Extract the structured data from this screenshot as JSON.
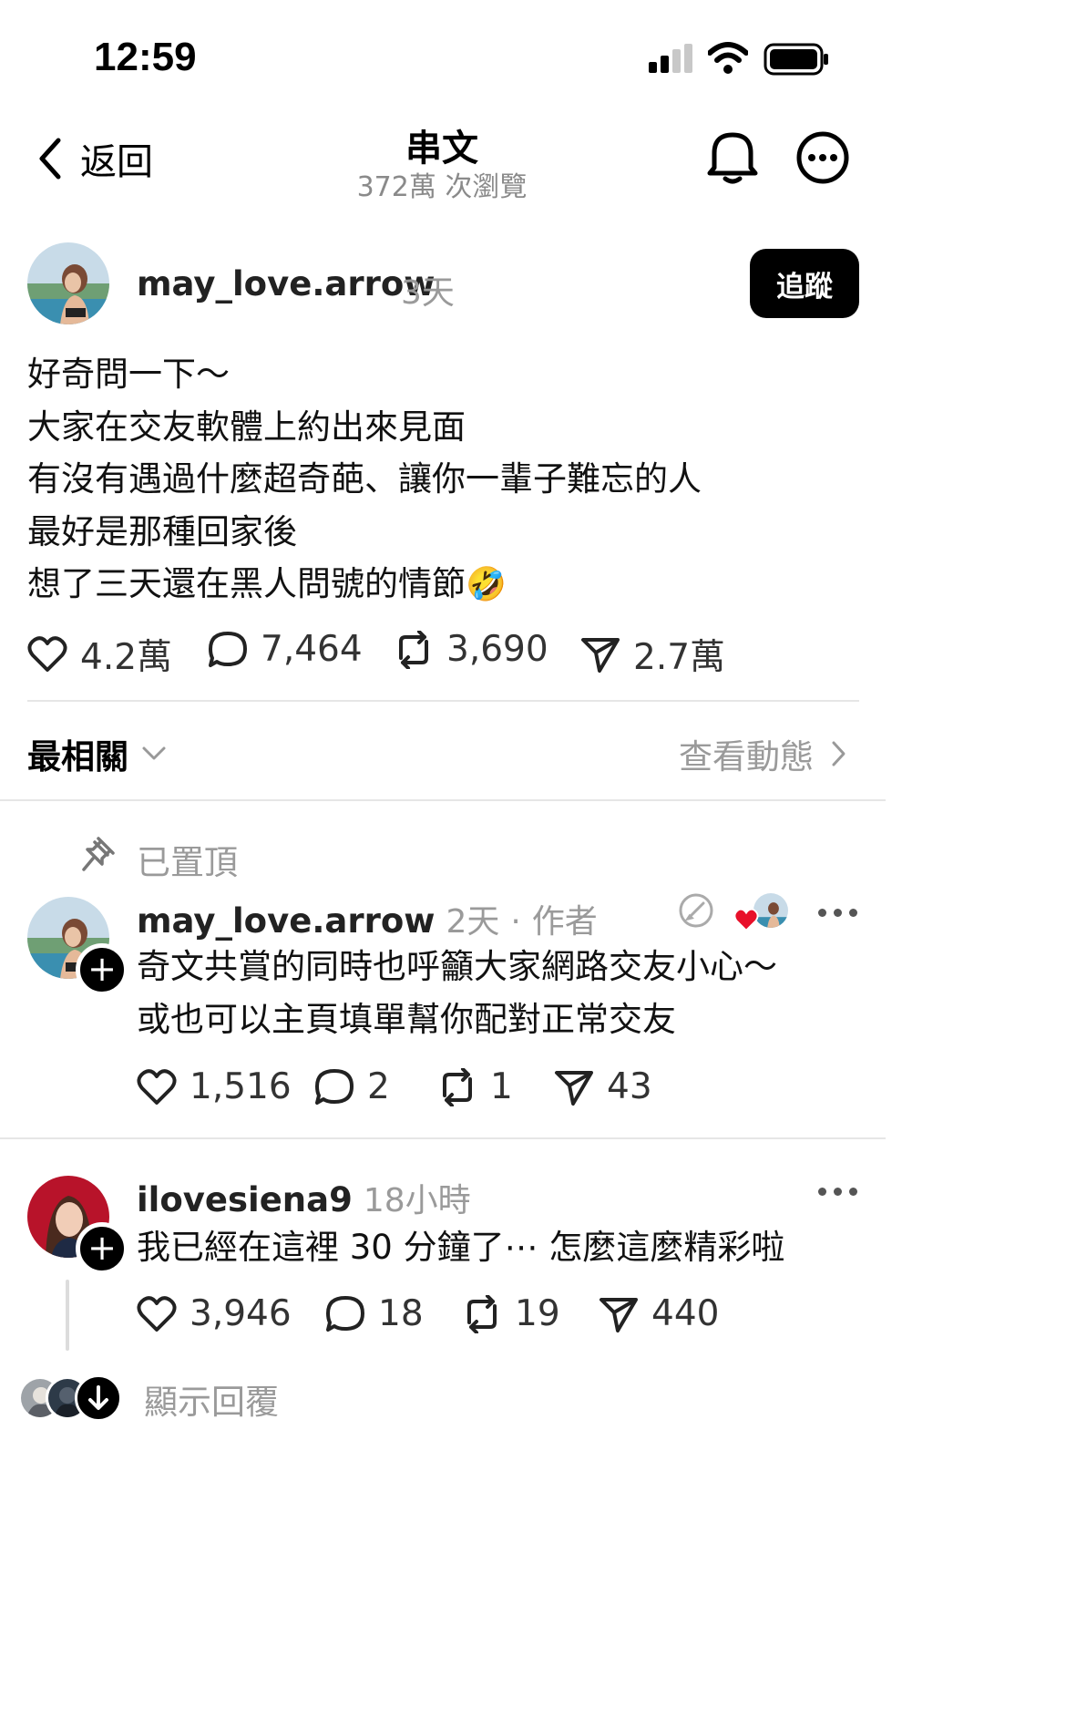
{
  "status_bar": {
    "time": "12:59"
  },
  "header": {
    "back_label": "返回",
    "title": "串文",
    "views": "372萬 次瀏覽"
  },
  "post": {
    "username": "may_love.arrow",
    "time": "3天",
    "follow_label": "追蹤",
    "lines": [
      "好奇問一下～",
      "大家在交友軟體上約出來見面",
      "有沒有遇過什麼超奇葩、讓你一輩子難忘的人",
      "最好是那種回家後",
      "想了三天還在黑人問號的情節"
    ],
    "emoji": "🤣",
    "likes": "4.2萬",
    "comments": "7,464",
    "reposts": "3,690",
    "shares": "2.7萬"
  },
  "sort": {
    "label": "最相關",
    "view_activity": "查看動態"
  },
  "pinned": {
    "label": "已置頂",
    "username": "may_love.arrow",
    "time": "2天",
    "author_tag": "作者",
    "lines": [
      "奇文共賞的同時也呼籲大家網路交友小心～",
      "或也可以主頁填單幫你配對正常交友"
    ],
    "likes": "1,516",
    "comments": "2",
    "reposts": "1",
    "shares": "43"
  },
  "reply": {
    "username": "ilovesiena9",
    "time": "18小時",
    "text": "我已經在這裡 30 分鐘了⋯ 怎麼這麼精彩啦",
    "likes": "3,946",
    "comments": "18",
    "reposts": "19",
    "shares": "440",
    "show_replies": "顯示回覆"
  },
  "colors": {
    "accent_red": "#e8102a",
    "divider": "#e6e6e6",
    "muted": "#9a9a9a"
  }
}
